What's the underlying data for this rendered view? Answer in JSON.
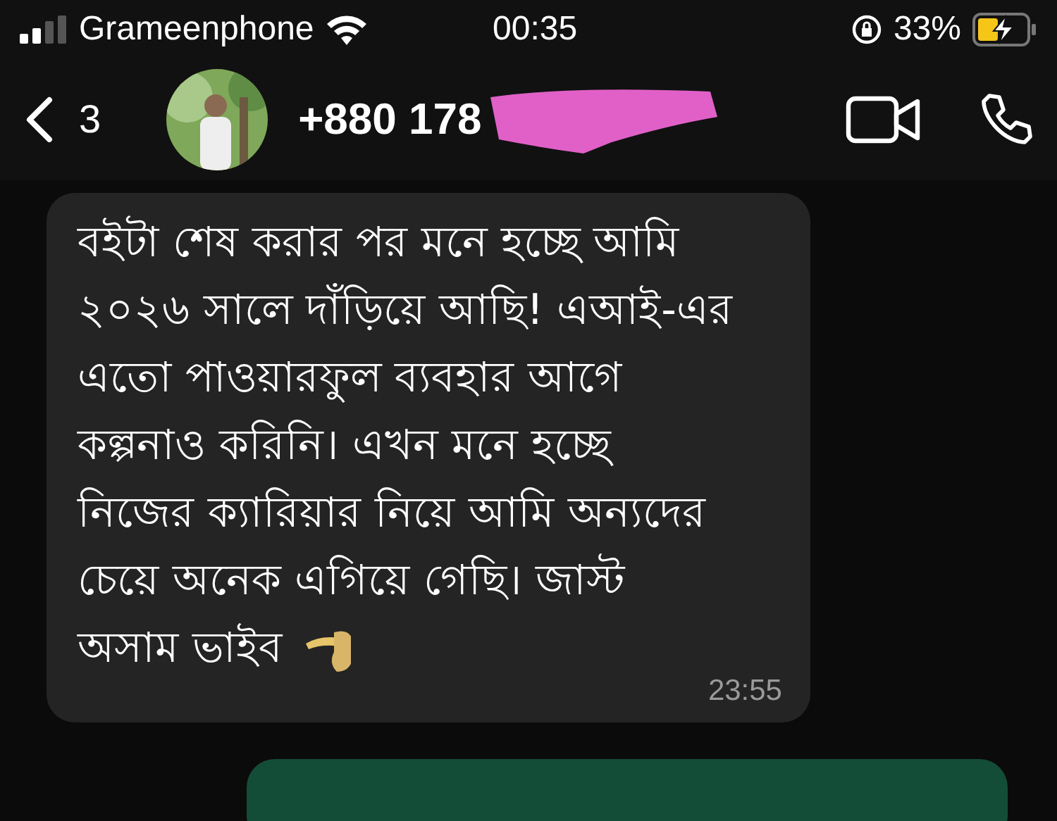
{
  "status_bar": {
    "carrier": "Grameenphone",
    "time": "00:35",
    "battery": "33%"
  },
  "header": {
    "back_count": "3",
    "contact": "+880 178"
  },
  "messages": [
    {
      "kind": "incoming",
      "lines": [
        "বইটা শেষ করার পর মনে হচ্ছে আমি",
        "২০২৬ সালে দাঁড়িয়ে আছি! এআই-এর",
        "এতো পাওয়ারফুল ব্যবহার আগে",
        "কল্পনাও করিনি। এখন মনে হচ্ছে",
        "নিজের ক্যারিয়ার নিয়ে আমি অন্যদের",
        "চেয়ে অনেক এগিয়ে গেছি। জাস্ট",
        "অসাম ভাইব"
      ],
      "time": "23:55"
    },
    {
      "kind": "outgoing"
    }
  ]
}
